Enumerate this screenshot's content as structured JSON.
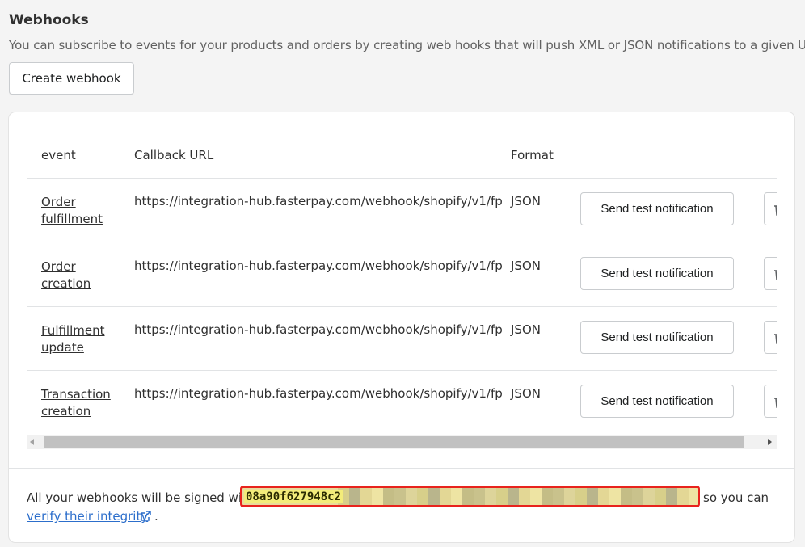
{
  "page": {
    "title": "Webhooks",
    "description": "You can subscribe to events for your products and orders by creating web hooks that will push XML or JSON notifications to a given URL.",
    "create_button": "Create webhook"
  },
  "table": {
    "headers": {
      "event": "event",
      "url": "Callback URL",
      "format": "Format"
    },
    "rows": [
      {
        "event": "Order fulfillment",
        "url": "https://integration-hub.fasterpay.com/webhook/shopify/v1/fp",
        "format": "JSON",
        "action": "Send test notification"
      },
      {
        "event": "Order creation",
        "url": "https://integration-hub.fasterpay.com/webhook/shopify/v1/fp",
        "format": "JSON",
        "action": "Send test notification"
      },
      {
        "event": "Fulfillment update",
        "url": "https://integration-hub.fasterpay.com/webhook/shopify/v1/fp",
        "format": "JSON",
        "action": "Send test notification"
      },
      {
        "event": "Transaction creation",
        "url": "https://integration-hub.fasterpay.com/webhook/shopify/v1/fp",
        "format": "JSON",
        "action": "Send test notification"
      }
    ]
  },
  "footer": {
    "prefix": "All your webhooks will be signed with",
    "secret_visible": "08a90f627948c2",
    "suffix": "so you can",
    "link": "verify their integrity",
    "end": "."
  },
  "colors": {
    "link": "#2c6ecb",
    "highlight_border": "#e8231d"
  }
}
